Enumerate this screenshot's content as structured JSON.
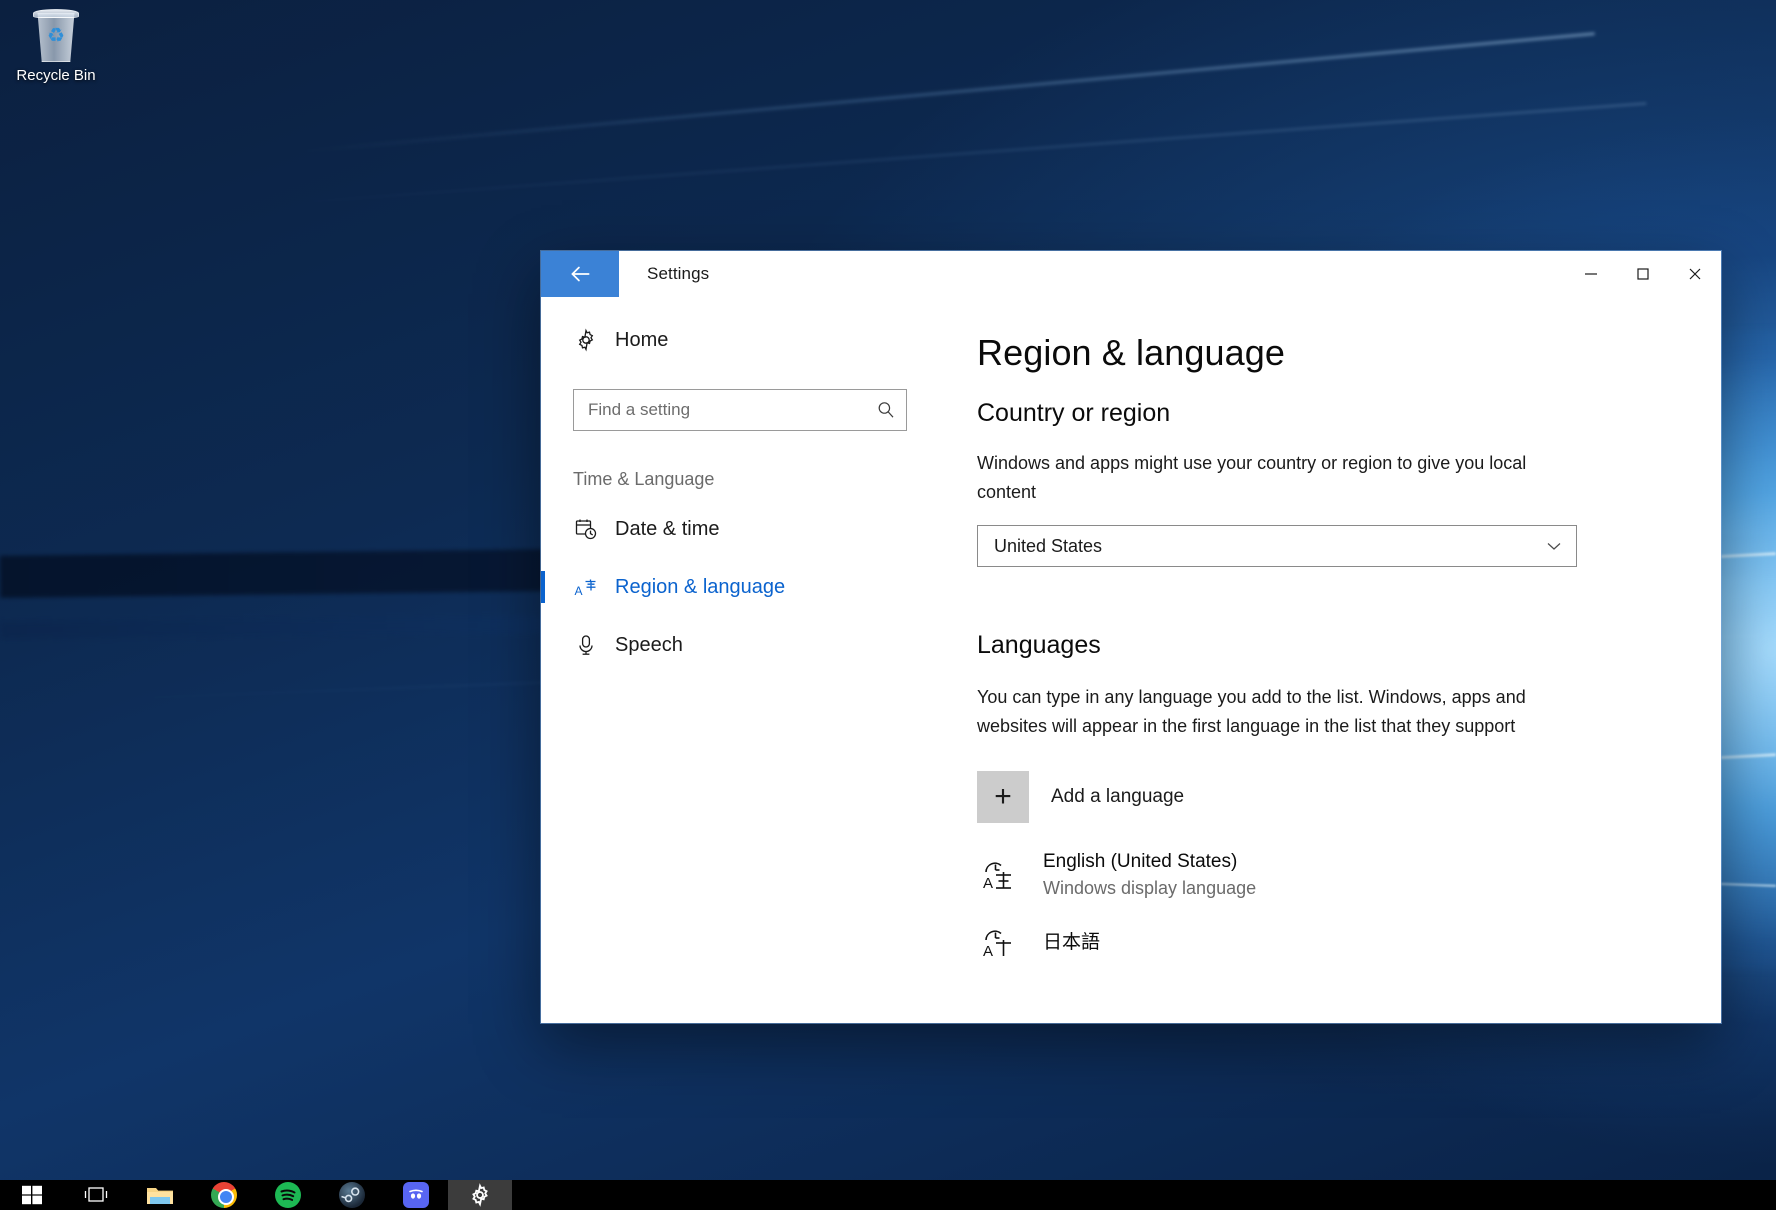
{
  "desktop": {
    "recycle_bin": {
      "label": "Recycle Bin",
      "icon": "recycle-bin-icon"
    }
  },
  "window": {
    "title": "Settings",
    "back_icon": "back-arrow-icon",
    "controls": {
      "minimize": "minimize-icon",
      "maximize": "maximize-icon",
      "close": "close-icon"
    }
  },
  "sidebar": {
    "home": {
      "label": "Home",
      "icon": "gear-icon"
    },
    "search": {
      "placeholder": "Find a setting",
      "value": "",
      "icon": "search-icon"
    },
    "group_title": "Time & Language",
    "items": [
      {
        "label": "Date & time",
        "icon": "calendar-clock-icon",
        "selected": false
      },
      {
        "label": "Region & language",
        "icon": "language-icon",
        "selected": true
      },
      {
        "label": "Speech",
        "icon": "microphone-icon",
        "selected": false
      }
    ]
  },
  "content": {
    "page_title": "Region & language",
    "country_section": {
      "title": "Country or region",
      "description": "Windows and apps might use your country or region to give you local content",
      "select": {
        "value": "United States",
        "chevron_icon": "chevron-down-icon"
      }
    },
    "languages_section": {
      "title": "Languages",
      "description": "You can type in any language you add to the list. Windows, apps and websites will appear in the first language in the list that they support",
      "add_language": {
        "label": "Add a language",
        "icon": "plus-icon"
      },
      "items": [
        {
          "name": "English (United States)",
          "sub": "Windows display language",
          "icon": "language-icon"
        },
        {
          "name": "日本語",
          "sub": "",
          "icon": "language-icon"
        }
      ]
    }
  },
  "taskbar": {
    "items": [
      {
        "name": "start",
        "label": "Start",
        "icon": "windows-logo-icon",
        "active": false
      },
      {
        "name": "task-view",
        "label": "Task View",
        "icon": "task-view-icon",
        "active": false
      },
      {
        "name": "file-explorer",
        "label": "File Explorer",
        "icon": "folder-icon",
        "active": false
      },
      {
        "name": "chrome",
        "label": "Google Chrome",
        "icon": "chrome-icon",
        "active": false
      },
      {
        "name": "spotify",
        "label": "Spotify",
        "icon": "spotify-icon",
        "active": false
      },
      {
        "name": "steam",
        "label": "Steam",
        "icon": "steam-icon",
        "active": false
      },
      {
        "name": "discord",
        "label": "Discord",
        "icon": "discord-icon",
        "active": false
      },
      {
        "name": "settings",
        "label": "Settings",
        "icon": "gear-icon",
        "active": true
      }
    ]
  },
  "colors": {
    "accent": "#0b63ce",
    "back_button": "#3b82d6",
    "taskbar": "#000000",
    "active_task": "#3c3c3c"
  }
}
